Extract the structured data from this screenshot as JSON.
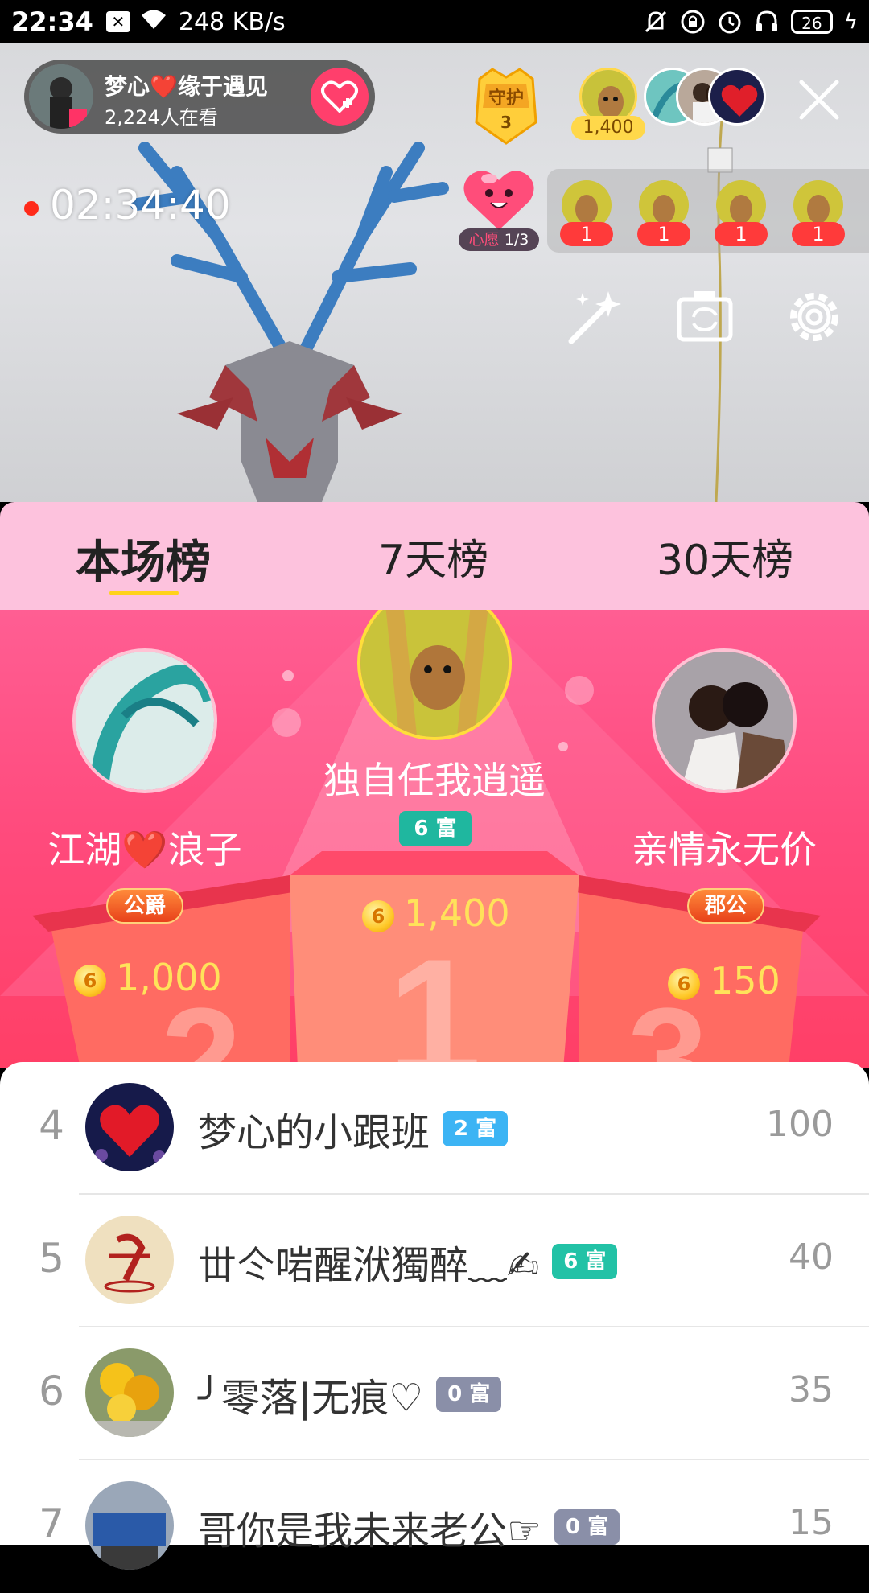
{
  "status_bar": {
    "time": "22:34",
    "net_speed": "248 KB/s",
    "battery": "26"
  },
  "live": {
    "host_name": "梦心❤️缘于遇见",
    "viewers": "2,224人在看",
    "guard_label": "守护",
    "guard_count": "3",
    "top_contribution": "1,400",
    "timer": "02:34:40",
    "wish_label": "心愿",
    "wish_progress": "1/3",
    "gift_counts": [
      "1",
      "1",
      "1",
      "1"
    ]
  },
  "tabs": [
    "本场榜",
    "7天榜",
    "30天榜"
  ],
  "podium": {
    "first": {
      "name": "独自任我逍遥",
      "rich": "6 富",
      "score": "1,400"
    },
    "second": {
      "name": "江湖❤️浪子",
      "title": "公爵",
      "score": "1,000"
    },
    "third": {
      "name": "亲情永无价",
      "title": "郡公",
      "score": "150"
    },
    "coin_glyph": "6"
  },
  "ranking": [
    {
      "rank": "4",
      "name": "梦心的小跟班",
      "rich": "2 富",
      "rich_color": "#3cb4f4",
      "score": "100"
    },
    {
      "rank": "5",
      "name": "丗仒啱醒洑獨醉﹏✍",
      "rich": "6 富",
      "rich_color": "#22c2a6",
      "score": "40"
    },
    {
      "rank": "6",
      "name": "╯零落|无痕♡",
      "rich": "0 富",
      "rich_color": "#8a8fa8",
      "score": "35"
    },
    {
      "rank": "7",
      "name": "哥你是我未来老公☞",
      "rich": "0 富",
      "rich_color": "#8a8fa8",
      "score": "15"
    }
  ]
}
